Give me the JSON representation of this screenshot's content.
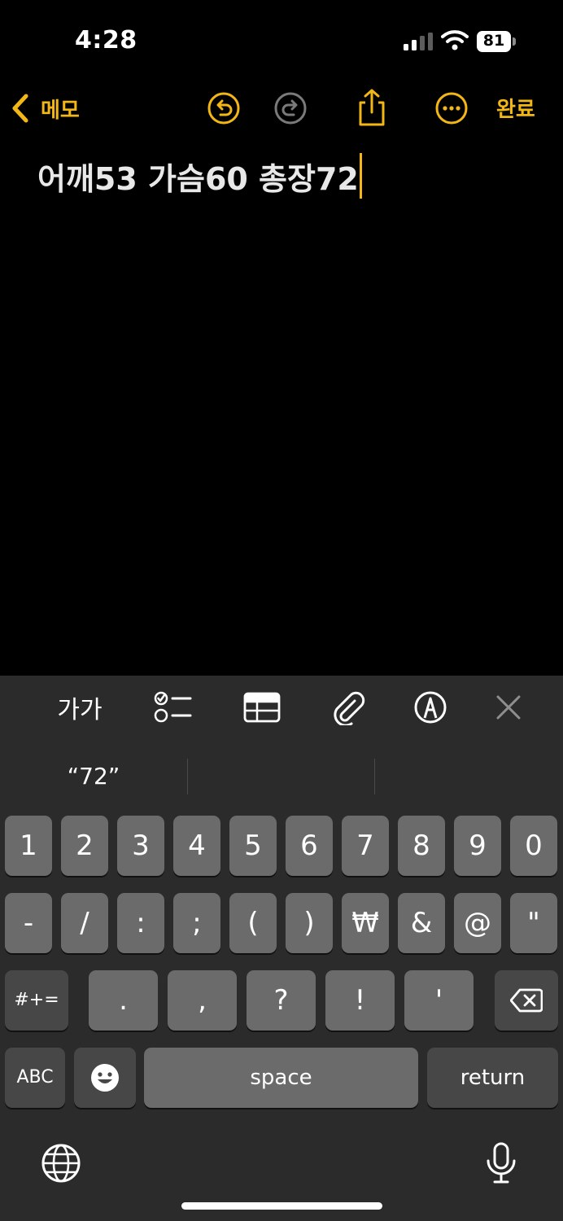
{
  "status_bar": {
    "time": "4:28",
    "battery": "81"
  },
  "nav": {
    "back_label": "메모",
    "done_label": "완료"
  },
  "note": {
    "text": "어깨53 가슴60 총장72"
  },
  "toolbar": {
    "format_label": "가가"
  },
  "suggestions": [
    "“72”",
    "",
    ""
  ],
  "keyboard": {
    "row1": [
      "1",
      "2",
      "3",
      "4",
      "5",
      "6",
      "7",
      "8",
      "9",
      "0"
    ],
    "row2": [
      "-",
      "/",
      ":",
      ";",
      "(",
      ")",
      "₩",
      "&",
      "@",
      "\""
    ],
    "row3": {
      "mode_label": "#+=",
      "keys": [
        ".",
        ",",
        "?",
        "!",
        "'"
      ]
    },
    "row4": {
      "abc_label": "ABC",
      "space_label": "space",
      "return_label": "return"
    }
  },
  "colors": {
    "accent": "#f2b617",
    "background": "#000000",
    "keyboard_bg": "#2b2b2b",
    "key_bg": "#6b6b6b"
  }
}
